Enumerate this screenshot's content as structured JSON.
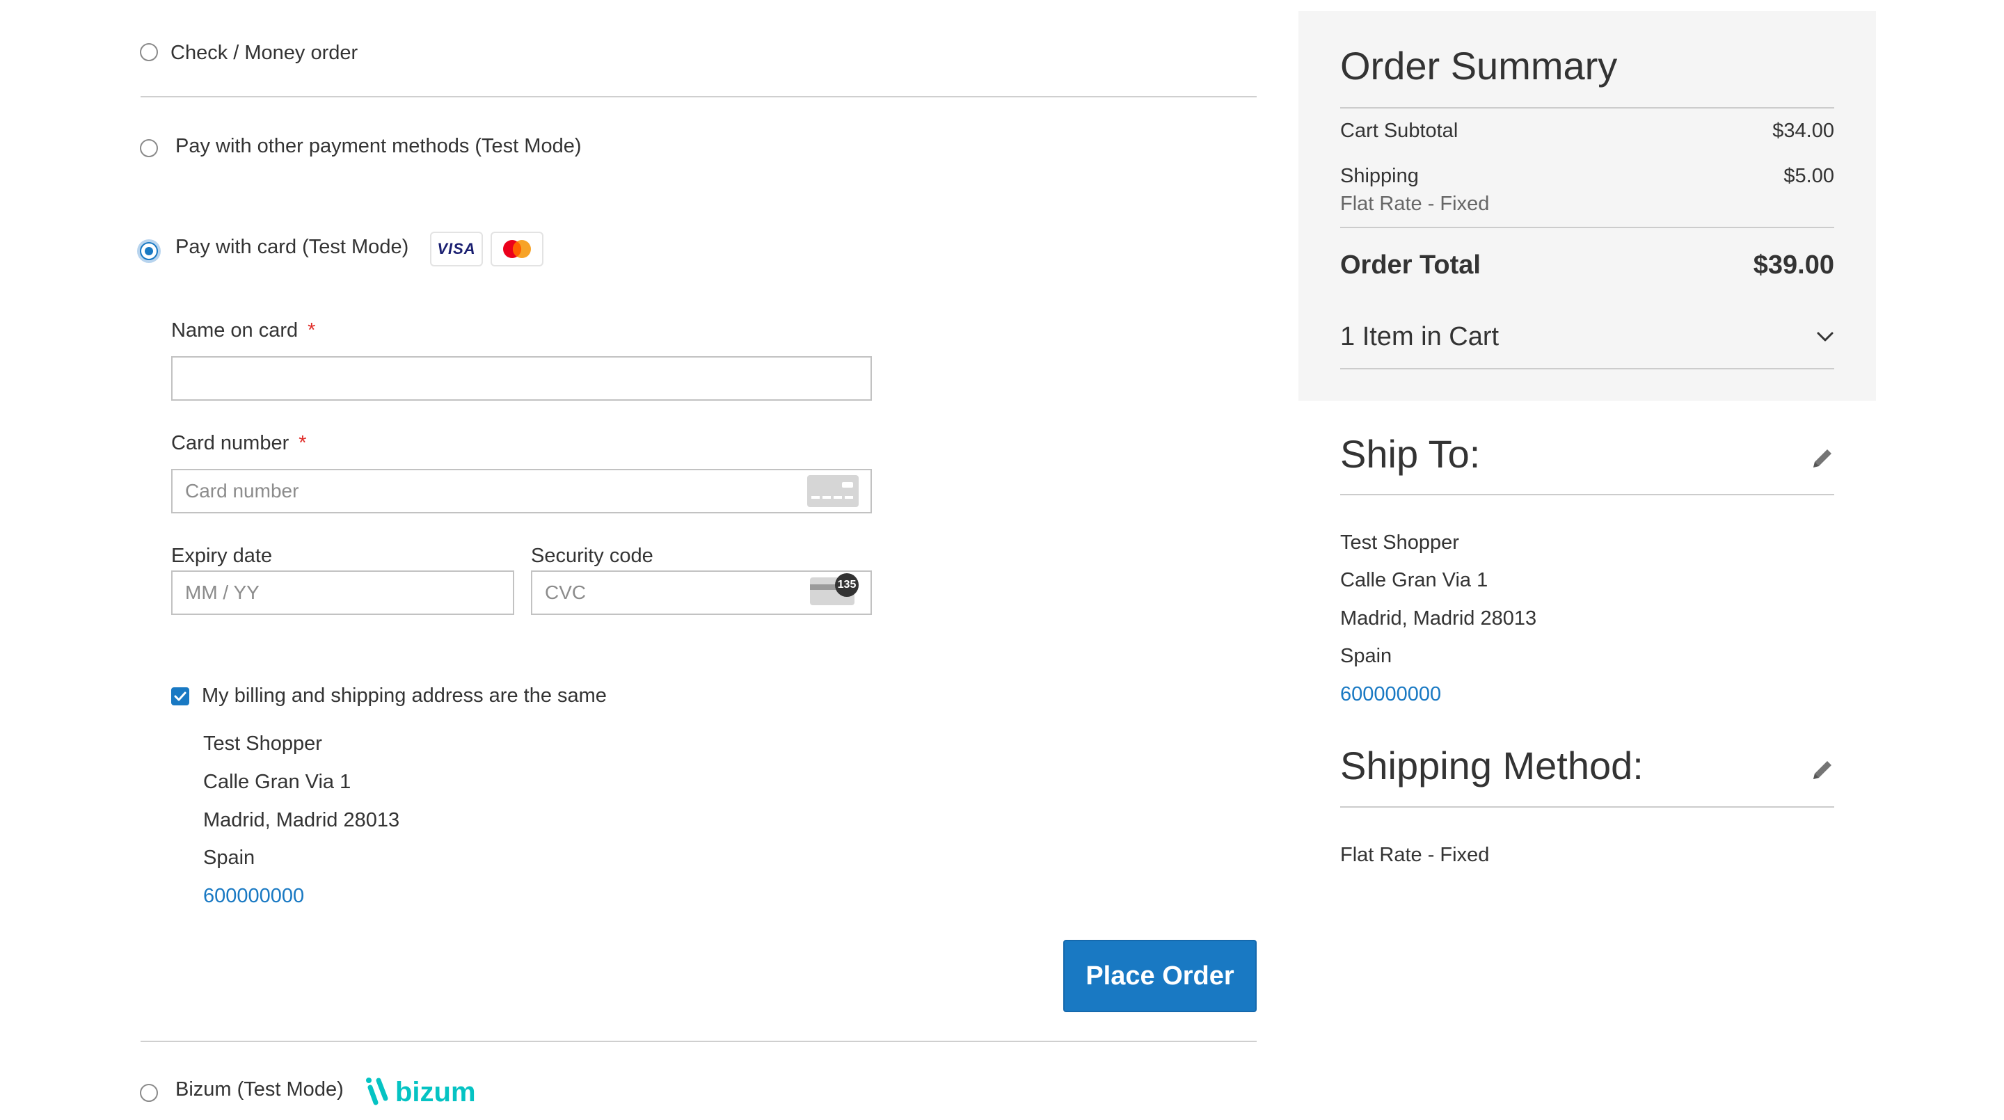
{
  "payment": {
    "check_money_order": "Check / Money order",
    "other_methods": "Pay with other payment methods (Test Mode)",
    "card": "Pay with card (Test Mode)",
    "visa": "VISA",
    "bizum": "Bizum (Test Mode)",
    "bizum_logo_text": "bizum"
  },
  "card_form": {
    "name_label": "Name on card",
    "number_label": "Card number",
    "number_placeholder": "Card number",
    "expiry_label": "Expiry date",
    "expiry_placeholder": "MM / YY",
    "cvc_label": "Security code",
    "cvc_placeholder": "CVC",
    "cvc_badge": "135",
    "required_mark": "*"
  },
  "billing": {
    "same_label": "My billing and shipping address are the same",
    "name": "Test Shopper",
    "street": "Calle Gran Via 1",
    "city": "Madrid, Madrid 28013",
    "country": "Spain",
    "phone": "600000000"
  },
  "place_order": "Place Order",
  "summary": {
    "title": "Order Summary",
    "subtotal_label": "Cart Subtotal",
    "subtotal_value": "$34.00",
    "shipping_label": "Shipping",
    "shipping_value": "$5.00",
    "shipping_method": "Flat Rate - Fixed",
    "total_label": "Order Total",
    "total_value": "$39.00",
    "items_in_cart": "1 Item in Cart"
  },
  "ship_to": {
    "title": "Ship To:",
    "name": "Test Shopper",
    "street": "Calle Gran Via 1",
    "city": "Madrid, Madrid 28013",
    "country": "Spain",
    "phone": "600000000"
  },
  "shipping_method": {
    "title": "Shipping Method:",
    "value": "Flat Rate - Fixed"
  },
  "colors": {
    "accent": "#1979c3",
    "required": "#e02b27",
    "bizum": "#05c3c3"
  }
}
